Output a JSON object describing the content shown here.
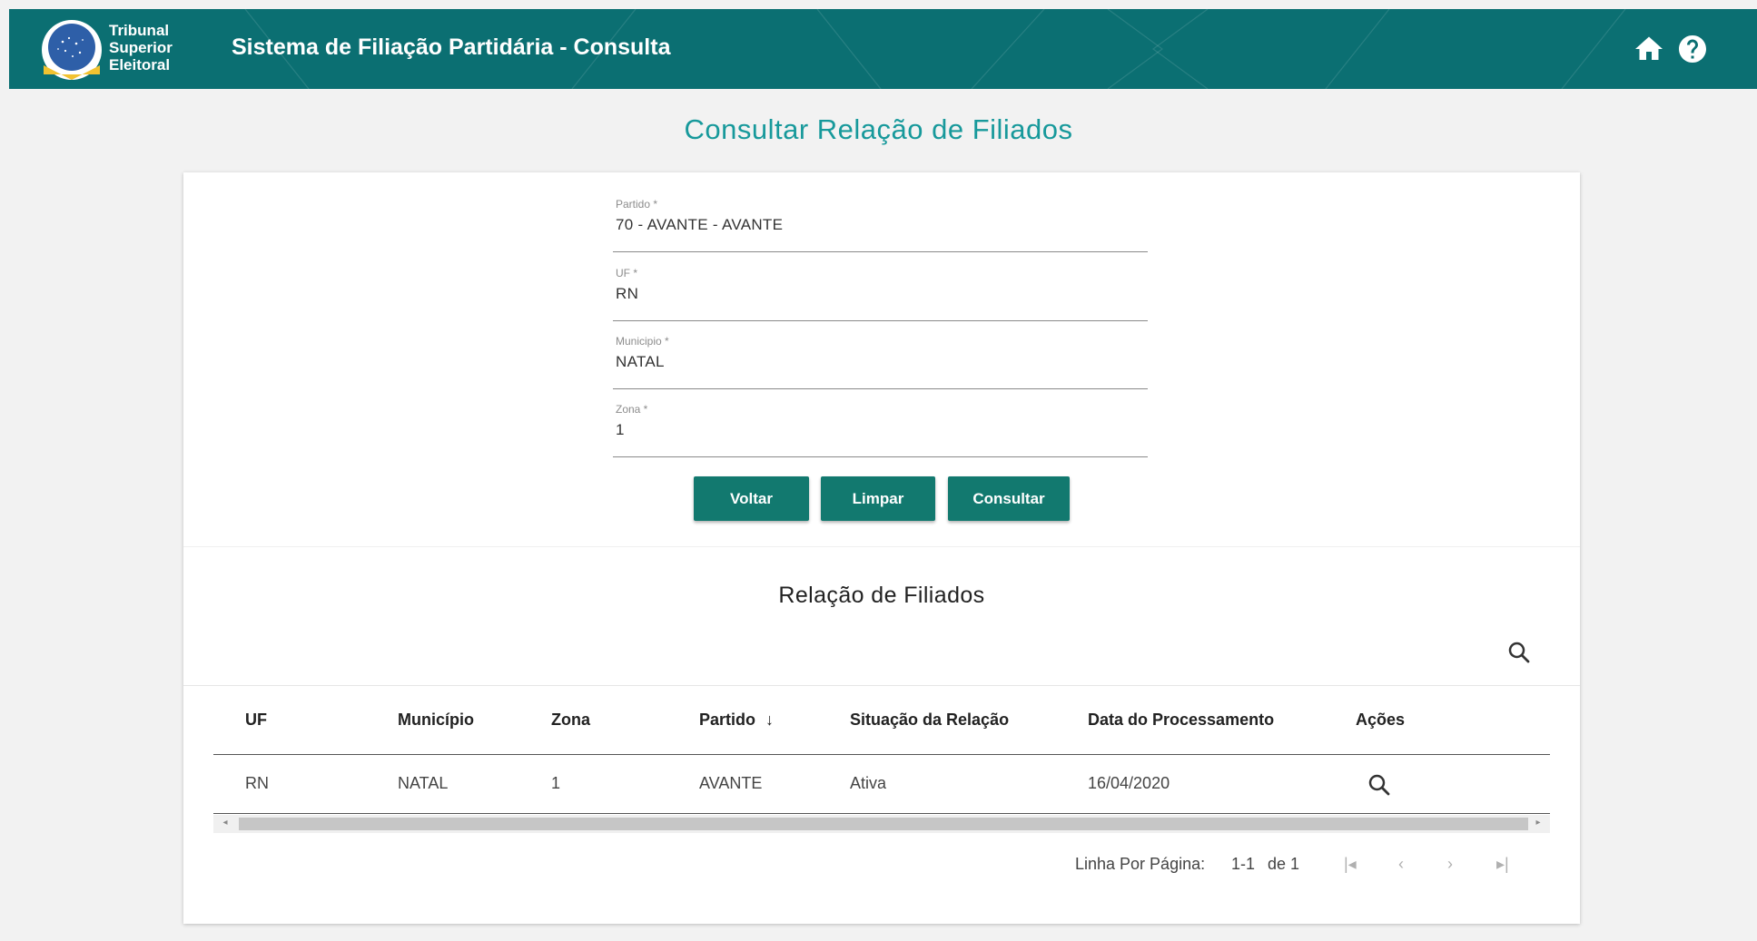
{
  "header": {
    "brand_line1": "Tribunal",
    "brand_line2": "Superior",
    "brand_line3": "Eleitoral",
    "app_title": "Sistema de Filiação Partidária - Consulta",
    "icons": [
      "home-icon",
      "help-icon"
    ]
  },
  "page_title": "Consultar Relação de Filiados",
  "form": {
    "partido": {
      "label": "Partido *",
      "value": "70 - AVANTE - AVANTE"
    },
    "uf": {
      "label": "UF *",
      "value": "RN"
    },
    "municipio": {
      "label": "Municipio *",
      "value": "NATAL"
    },
    "zona": {
      "label": "Zona *",
      "value": "1"
    },
    "buttons": {
      "voltar": "Voltar",
      "limpar": "Limpar",
      "consultar": "Consultar"
    }
  },
  "results": {
    "title": "Relação de Filiados",
    "columns": [
      "UF",
      "Município",
      "Zona",
      "Partido",
      "Situação da Relação",
      "Data do Processamento",
      "Ações"
    ],
    "sort_indicator": "↓",
    "rows": [
      {
        "uf": "RN",
        "municipio": "NATAL",
        "zona": "1",
        "partido": "AVANTE",
        "situacao": "Ativa",
        "data": "16/04/2020"
      }
    ]
  },
  "pagination": {
    "label": "Linha Por Página:",
    "range": "1-1",
    "of": "de 1"
  },
  "colors": {
    "header_bg": "#0b6f72",
    "accent_title": "#17999b",
    "button_bg": "#12796f"
  }
}
